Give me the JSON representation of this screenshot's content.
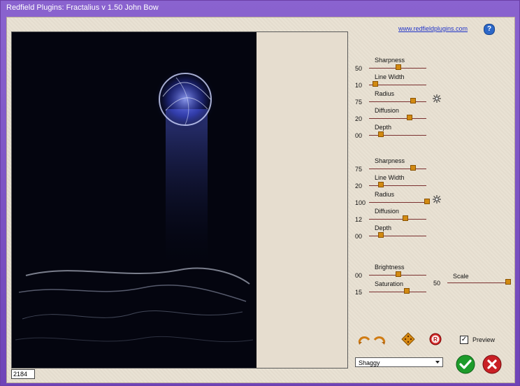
{
  "window": {
    "title": "Redfield Plugins: Fractalius v 1.50   John Bow"
  },
  "links": {
    "website": "www.redfieldplugins.com"
  },
  "status": {
    "resolution": "2184"
  },
  "group1": {
    "sliders": [
      {
        "label": "Sharpness",
        "value": "50",
        "fraction": 0.5
      },
      {
        "label": "Line Width",
        "value": "10",
        "fraction": 0.1
      },
      {
        "label": "Radius",
        "value": "75",
        "fraction": 0.75
      },
      {
        "label": "Diffusion",
        "value": "20",
        "fraction": 0.7
      },
      {
        "label": "Depth",
        "value": "00",
        "fraction": 0.2
      }
    ]
  },
  "group2": {
    "sliders": [
      {
        "label": "Sharpness",
        "value": "75",
        "fraction": 0.75
      },
      {
        "label": "Line Width",
        "value": "20",
        "fraction": 0.2
      },
      {
        "label": "Radius",
        "value": "100",
        "fraction": 1.0
      },
      {
        "label": "Diffusion",
        "value": "12",
        "fraction": 0.62
      },
      {
        "label": "Depth",
        "value": "00",
        "fraction": 0.2
      }
    ]
  },
  "group3": {
    "sliders": [
      {
        "label": "Brightness",
        "value": "00",
        "fraction": 0.5
      },
      {
        "label": "Saturation",
        "value": "15",
        "fraction": 0.65
      }
    ],
    "scale": {
      "label": "Scale",
      "value": "50",
      "fraction": 1.0
    }
  },
  "controls": {
    "preview_label": "Preview",
    "preview_checked": true,
    "preset_selected": "Shaggy"
  },
  "colors": {
    "title_bar": "#7b54c6",
    "slider_thumb": "#d28a12",
    "ok_green": "#1d9b2a",
    "cancel_red": "#c92025"
  },
  "icons": [
    "help-icon",
    "burst-icon",
    "rotate-left-icon",
    "rotate-right-icon",
    "dice-icon",
    "reset-icon",
    "checkmark-icon",
    "close-icon"
  ]
}
